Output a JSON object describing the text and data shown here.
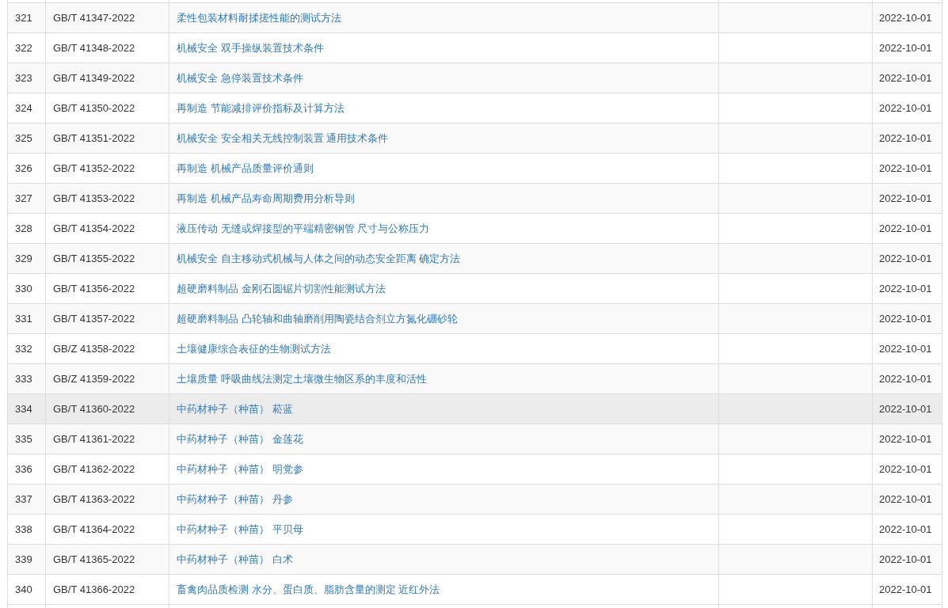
{
  "table": {
    "rows": [
      {
        "index": "321",
        "code": "GB/T 41347-2022",
        "title": "柔性包装材料耐揉搓性能的测试方法",
        "date": "2022-10-01",
        "hovered": false
      },
      {
        "index": "322",
        "code": "GB/T 41348-2022",
        "title": "机械安全 双手操纵装置技术条件",
        "date": "2022-10-01",
        "hovered": false
      },
      {
        "index": "323",
        "code": "GB/T 41349-2022",
        "title": "机械安全 急停装置技术条件",
        "date": "2022-10-01",
        "hovered": false
      },
      {
        "index": "324",
        "code": "GB/T 41350-2022",
        "title": "再制造 节能减排评价指标及计算方法",
        "date": "2022-10-01",
        "hovered": false
      },
      {
        "index": "325",
        "code": "GB/T 41351-2022",
        "title": "机械安全 安全相关无线控制装置 通用技术条件",
        "date": "2022-10-01",
        "hovered": false
      },
      {
        "index": "326",
        "code": "GB/T 41352-2022",
        "title": "再制造 机械产品质量评价通则",
        "date": "2022-10-01",
        "hovered": false
      },
      {
        "index": "327",
        "code": "GB/T 41353-2022",
        "title": "再制造 机械产品寿命周期费用分析导则",
        "date": "2022-10-01",
        "hovered": false
      },
      {
        "index": "328",
        "code": "GB/T 41354-2022",
        "title": "液压传动 无缝或焊接型的平端精密钢管 尺寸与公称压力",
        "date": "2022-10-01",
        "hovered": false
      },
      {
        "index": "329",
        "code": "GB/T 41355-2022",
        "title": "机械安全 自主移动式机械与人体之间的动态安全距离 确定方法",
        "date": "2022-10-01",
        "hovered": false
      },
      {
        "index": "330",
        "code": "GB/T 41356-2022",
        "title": "超硬磨料制品 金刚石圆锯片切割性能测试方法",
        "date": "2022-10-01",
        "hovered": false
      },
      {
        "index": "331",
        "code": "GB/T 41357-2022",
        "title": "超硬磨料制品 凸轮轴和曲轴磨削用陶瓷结合剂立方氮化硼砂轮",
        "date": "2022-10-01",
        "hovered": false
      },
      {
        "index": "332",
        "code": "GB/Z 41358-2022",
        "title": "土壤健康综合表征的生物测试方法",
        "date": "2022-10-01",
        "hovered": false
      },
      {
        "index": "333",
        "code": "GB/Z 41359-2022",
        "title": "土壤质量 呼吸曲线法测定土壤微生物区系的丰度和活性",
        "date": "2022-10-01",
        "hovered": false
      },
      {
        "index": "334",
        "code": "GB/T 41360-2022",
        "title": "中药材种子（种苗） 菘蓝",
        "date": "2022-10-01",
        "hovered": true
      },
      {
        "index": "335",
        "code": "GB/T 41361-2022",
        "title": "中药材种子（种苗） 金莲花",
        "date": "2022-10-01",
        "hovered": false
      },
      {
        "index": "336",
        "code": "GB/T 41362-2022",
        "title": "中药材种子（种苗） 明党参",
        "date": "2022-10-01",
        "hovered": false
      },
      {
        "index": "337",
        "code": "GB/T 41363-2022",
        "title": "中药材种子（种苗） 丹参",
        "date": "2022-10-01",
        "hovered": false
      },
      {
        "index": "338",
        "code": "GB/T 41364-2022",
        "title": "中药材种子（种苗） 平贝母",
        "date": "2022-10-01",
        "hovered": false
      },
      {
        "index": "339",
        "code": "GB/T 41365-2022",
        "title": "中药材种子（种苗） 白术",
        "date": "2022-10-01",
        "hovered": false
      },
      {
        "index": "340",
        "code": "GB/T 41366-2022",
        "title": "畜禽肉品质检测 水分、蛋白质、脂肪含量的测定 近红外法",
        "date": "2022-10-01",
        "hovered": false
      }
    ]
  }
}
